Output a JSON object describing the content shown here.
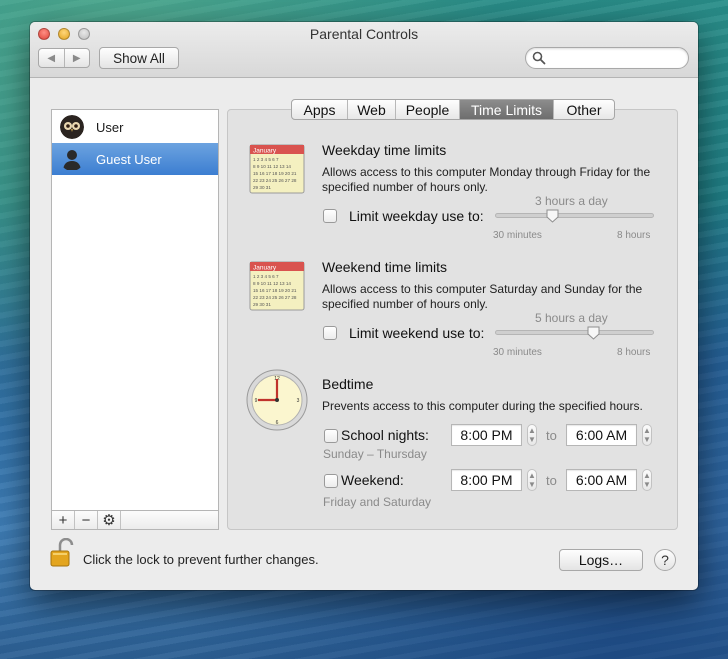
{
  "window": {
    "title": "Parental Controls",
    "show_all_label": "Show All",
    "search_placeholder": ""
  },
  "sidebar": {
    "users": [
      {
        "name": "User",
        "avatar_icon": "owl-avatar-icon",
        "selected": false
      },
      {
        "name": "Guest User",
        "avatar_icon": "guest-silhouette-icon",
        "selected": true
      }
    ],
    "buttons": [
      "+",
      "−",
      "⚙"
    ]
  },
  "tabs": [
    {
      "label": "Apps",
      "active": false
    },
    {
      "label": "Web",
      "active": false
    },
    {
      "label": "People",
      "active": false
    },
    {
      "label": "Time Limits",
      "active": true
    },
    {
      "label": "Other",
      "active": false
    }
  ],
  "weekday": {
    "icon": "calendar-icon",
    "calendar_month": "January",
    "title": "Weekday time limits",
    "desc_line1": "Allows access to this computer Monday through Friday for the",
    "desc_line2": "specified number of hours only.",
    "checkbox_label": "Limit weekday use to:",
    "checked": false,
    "slider_caption": "3 hours a day",
    "slider_min": "30 minutes",
    "slider_max": "8 hours",
    "slider_value_fraction": 0.36
  },
  "weekend": {
    "icon": "calendar-icon",
    "calendar_month": "January",
    "title": "Weekend time limits",
    "desc_line1": "Allows access to this computer Saturday and Sunday for the",
    "desc_line2": "specified number of hours only.",
    "checkbox_label": "Limit weekend use to:",
    "checked": false,
    "slider_caption": "5 hours a day",
    "slider_min": "30 minutes",
    "slider_max": "8 hours",
    "slider_value_fraction": 0.62
  },
  "bedtime": {
    "icon": "clock-icon",
    "title": "Bedtime",
    "desc": "Prevents access to this computer during the specified hours.",
    "school": {
      "label": "School nights:",
      "checked": false,
      "from": "8:00 PM",
      "to_label": "to",
      "to": "6:00 AM",
      "days": "Sunday – Thursday"
    },
    "weekend": {
      "label": "Weekend:",
      "checked": false,
      "from": "8:00 PM",
      "to_label": "to",
      "to": "6:00 AM",
      "days": "Friday and Saturday"
    }
  },
  "footer": {
    "lock_icon": "lock-open-icon",
    "lock_text": "Click the lock to prevent further changes.",
    "logs_label": "Logs…",
    "help_label": "?"
  },
  "colors": {
    "selection": "#3c7ed1",
    "active_tab": "#767676",
    "panel_bg": "#e2e2e2"
  }
}
